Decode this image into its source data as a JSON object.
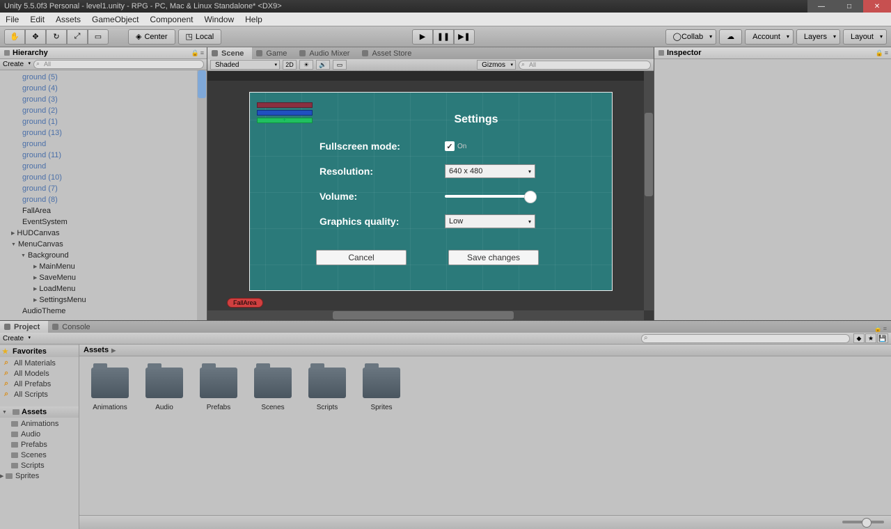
{
  "window": {
    "title": "Unity 5.5.0f3 Personal - level1.unity - RPG - PC, Mac & Linux Standalone* <DX9>"
  },
  "menubar": [
    "File",
    "Edit",
    "Assets",
    "GameObject",
    "Component",
    "Window",
    "Help"
  ],
  "toolbar": {
    "center_label": "Center",
    "local_label": "Local",
    "collab": "Collab",
    "account": "Account",
    "layers": "Layers",
    "layout": "Layout"
  },
  "hierarchy": {
    "tab": "Hierarchy",
    "create": "Create",
    "search_placeholder": "All",
    "items": [
      {
        "label": "ground (5)",
        "type": "blue"
      },
      {
        "label": "ground (4)",
        "type": "blue"
      },
      {
        "label": "ground (3)",
        "type": "blue"
      },
      {
        "label": "ground (2)",
        "type": "blue"
      },
      {
        "label": "ground (1)",
        "type": "blue"
      },
      {
        "label": "ground (13)",
        "type": "blue"
      },
      {
        "label": "ground",
        "type": "blue"
      },
      {
        "label": "ground (11)",
        "type": "blue"
      },
      {
        "label": "ground",
        "type": "blue"
      },
      {
        "label": "ground (10)",
        "type": "blue"
      },
      {
        "label": "ground (7)",
        "type": "blue"
      },
      {
        "label": "ground (8)",
        "type": "blue"
      },
      {
        "label": "FallArea",
        "type": "black"
      },
      {
        "label": "EventSystem",
        "type": "black"
      },
      {
        "label": "HUDCanvas",
        "type": "black",
        "expand": "closed"
      },
      {
        "label": "MenuCanvas",
        "type": "black",
        "expand": "open"
      },
      {
        "label": "Background",
        "type": "black",
        "expand": "open",
        "indent": 1
      },
      {
        "label": "MainMenu",
        "type": "black",
        "indent": 2,
        "exp": true
      },
      {
        "label": "SaveMenu",
        "type": "black",
        "indent": 2,
        "exp": true
      },
      {
        "label": "LoadMenu",
        "type": "black",
        "indent": 2,
        "exp": true
      },
      {
        "label": "SettingsMenu",
        "type": "black",
        "indent": 2,
        "exp": true
      },
      {
        "label": "AudioTheme",
        "type": "black"
      }
    ]
  },
  "center": {
    "tabs": [
      "Scene",
      "Game",
      "Audio Mixer",
      "Asset Store"
    ],
    "active_tab": 0,
    "shaded": "Shaded",
    "gizmos": "Gizmos",
    "btn2d": "2D",
    "search_placeholder": "All",
    "fallarea_label": "FallArea"
  },
  "settings": {
    "title": "Settings",
    "fullscreen_label": "Fullscreen mode:",
    "fullscreen_on": "On",
    "fullscreen_checked": true,
    "resolution_label": "Resolution:",
    "resolution_value": "640 x 480",
    "volume_label": "Volume:",
    "graphics_label": "Graphics quality:",
    "graphics_value": "Low",
    "cancel": "Cancel",
    "save": "Save changes"
  },
  "inspector": {
    "tab": "Inspector"
  },
  "project": {
    "tab": "Project",
    "console_tab": "Console",
    "create": "Create",
    "favorites_label": "Favorites",
    "favorites": [
      "All Materials",
      "All Models",
      "All Prefabs",
      "All Scripts"
    ],
    "assets_label": "Assets",
    "assets": [
      "Animations",
      "Audio",
      "Prefabs",
      "Scenes",
      "Scripts",
      "Sprites"
    ],
    "breadcrumb": "Assets",
    "folders": [
      "Animations",
      "Audio",
      "Prefabs",
      "Scenes",
      "Scripts",
      "Sprites"
    ]
  }
}
